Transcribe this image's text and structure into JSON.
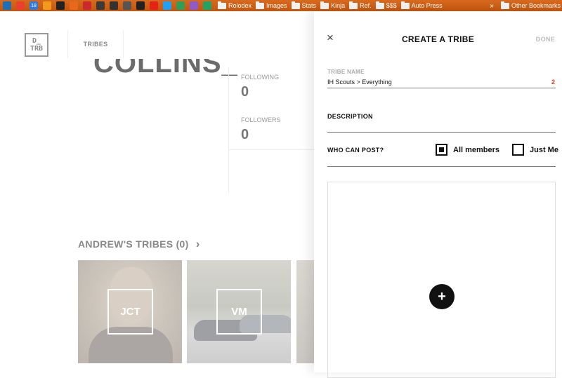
{
  "bookmarks": {
    "icons": [
      {
        "name": "trello-icon",
        "color": "#1f6fb5"
      },
      {
        "name": "gmail-icon",
        "color": "#e8412e"
      },
      {
        "name": "calendar-icon",
        "color": "#2b7be0"
      },
      {
        "name": "rss-icon",
        "color": "#f09a1b"
      },
      {
        "name": "kinja-k-icon",
        "color": "#222222"
      },
      {
        "name": "jalopnik-j-icon",
        "color": "#e9691c"
      },
      {
        "name": "eye-icon",
        "color": "#cc2a2a"
      },
      {
        "name": "ls-icon",
        "color": "#3a3a3a"
      },
      {
        "name": "screen-icon",
        "color": "#333333"
      },
      {
        "name": "car-icon",
        "color": "#555555"
      },
      {
        "name": "ta-icon",
        "color": "#222222"
      },
      {
        "name": "youtube-icon",
        "color": "#e62117"
      },
      {
        "name": "twitter-icon",
        "color": "#1da1f2"
      },
      {
        "name": "drive-icon",
        "color": "#2f9e57"
      },
      {
        "name": "flower-icon",
        "color": "#8e5ac8"
      },
      {
        "name": "sheets-icon",
        "color": "#21a366"
      }
    ],
    "calendar_day": "18",
    "folders": [
      "Rolodex",
      "Images",
      "Stats",
      "Kinja",
      "Ref.",
      "$$$",
      "Auto Press"
    ],
    "other": "Other Bookmarks",
    "chevron": "»"
  },
  "page": {
    "logo_top": "D_",
    "logo_bottom": "TRB",
    "nav_tab": "TRIBES",
    "username": "COLLINS_",
    "following_label": "FOLLOWING",
    "following_value": "0",
    "followers_label": "FOLLOWERS",
    "followers_value": "0",
    "tribes_heading": "ANDREW'S TRIBES (0)",
    "tribes_chevron": "›",
    "tiles": [
      {
        "badge": "JCT"
      },
      {
        "badge": "VM"
      }
    ]
  },
  "panel": {
    "close": "×",
    "title": "CREATE A TRIBE",
    "done": "DONE",
    "tribe_name_label": "TRIBE NAME",
    "tribe_name_value": "IH Scouts > Everything",
    "char_count": "2",
    "description_label": "DESCRIPTION",
    "who_can_post_label": "WHO CAN POST?",
    "option_all": "All members",
    "option_me": "Just Me",
    "add_button": "+"
  }
}
